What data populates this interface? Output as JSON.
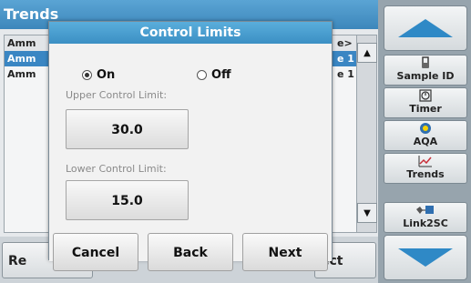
{
  "background": {
    "title": "Trends",
    "rows": [
      {
        "left": "Amm",
        "right": "e>"
      },
      {
        "left": "Amm",
        "right": "e 1"
      },
      {
        "left": "Amm",
        "right": "e 1"
      }
    ],
    "footer_left": "Re",
    "footer_right": "ect",
    "colors": {
      "selected_row": "#3a86c3",
      "title_bar": "#3d87bb"
    }
  },
  "sidebar": {
    "items": [
      {
        "label": "Sample ID",
        "icon": "flask-icon"
      },
      {
        "label": "Timer",
        "icon": "timer-icon"
      },
      {
        "label": "AQA",
        "icon": "aqa-icon"
      },
      {
        "label": "Trends",
        "icon": "trends-icon"
      },
      {
        "label": "Link2SC",
        "icon": "link2sc-icon"
      }
    ]
  },
  "dialog": {
    "title": "Control Limits",
    "on_label": "On",
    "off_label": "Off",
    "selected": "On",
    "upper_label": "Upper Control Limit:",
    "upper_value": "30.0",
    "lower_label": "Lower Control Limit:",
    "lower_value": "15.0",
    "cancel_label": "Cancel",
    "back_label": "Back",
    "next_label": "Next"
  }
}
